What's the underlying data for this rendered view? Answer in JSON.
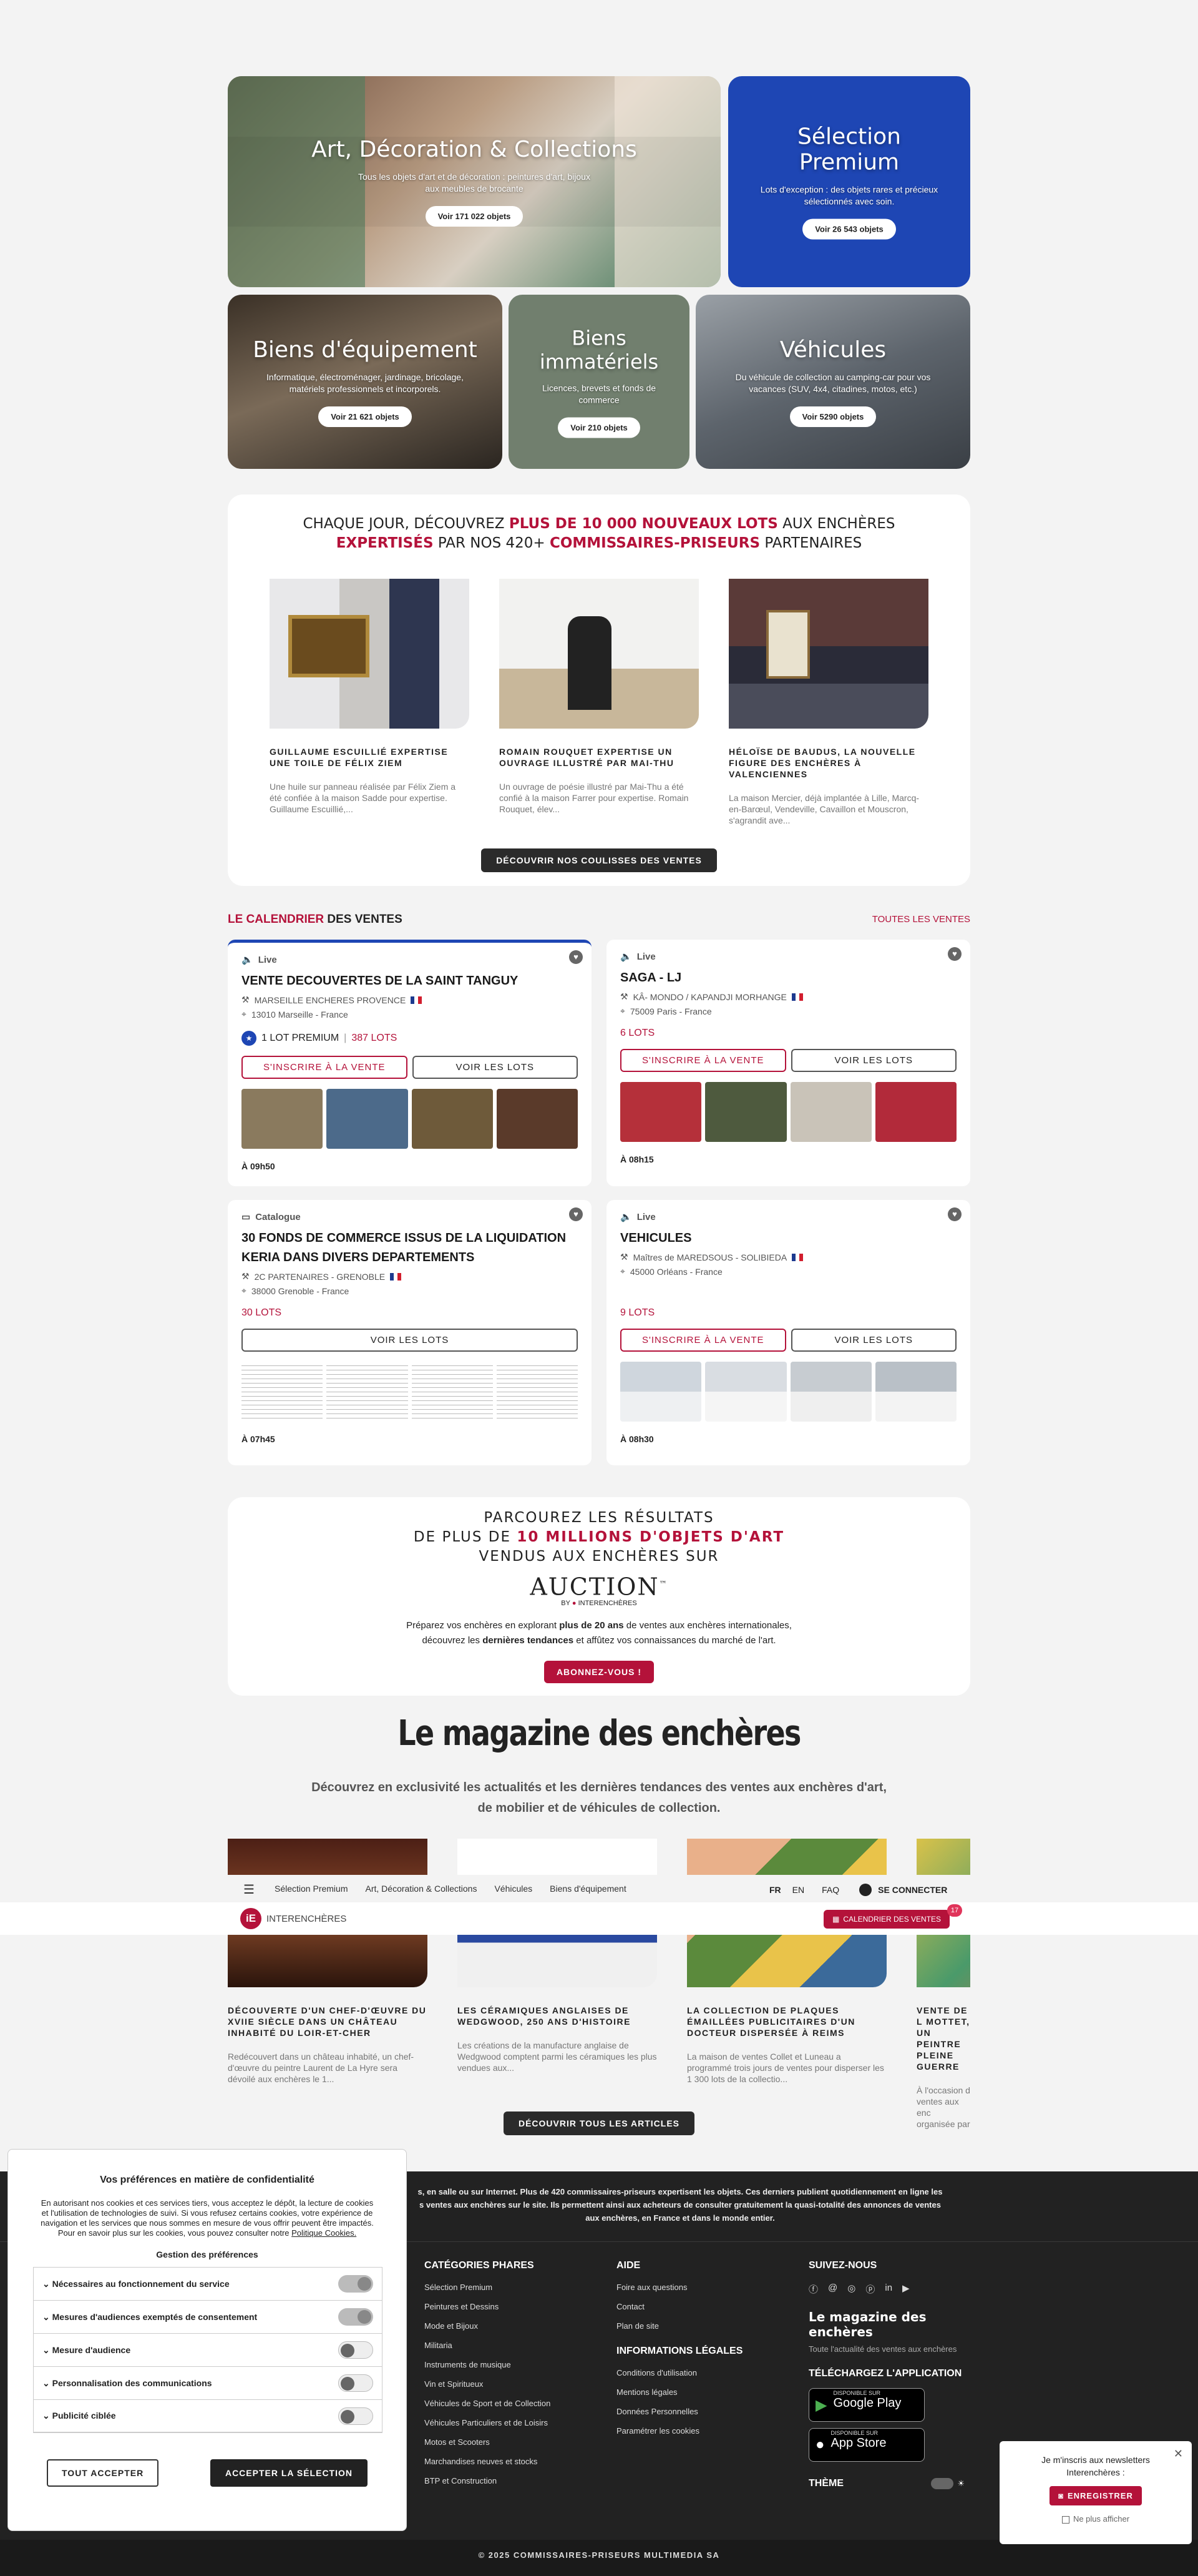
{
  "categories": [
    {
      "title": "Art, Décoration & Collections",
      "desc": "Tous les objets d'art et de décoration : peintures d'art, bijoux aux meubles de brocante",
      "btn": "Voir 171 022 objets"
    },
    {
      "title": "Sélection Premium",
      "desc": "Lots d'exception : des objets rares et précieux sélectionnés avec soin.",
      "btn": "Voir 26 543 objets"
    },
    {
      "title": "Biens d'équipement",
      "desc": "Informatique, électroménager, jardinage, bricolage, matériels professionnels et incorporels.",
      "btn": "Voir 21 621 objets"
    },
    {
      "title": "Biens immatériels",
      "desc": "Licences, brevets et fonds de commerce",
      "btn": "Voir 210 objets"
    },
    {
      "title": "Véhicules",
      "desc": "Du véhicule de collection au camping-car pour vos vacances (SUV, 4x4, citadines, motos, etc.)",
      "btn": "Voir 5290 objets"
    }
  ],
  "daily": {
    "l1a": "CHAQUE JOUR, DÉCOUVREZ ",
    "l1b": "PLUS DE 10 000 NOUVEAUX LOTS",
    "l1c": " AUX ENCHÈRES",
    "l2a": "EXPERTISÉS",
    "l2b": " PAR NOS 420+ ",
    "l2c": "COMMISSAIRES-PRISEURS",
    "l2d": " PARTENAIRES",
    "stories": [
      {
        "title": "GUILLAUME ESCUILLIÉ EXPERTISE UNE TOILE DE FÉLIX ZIEM",
        "text": "Une huile sur panneau réalisée par Félix Ziem a été confiée à la maison Sadde pour expertise. Guillaume Escuillié,..."
      },
      {
        "title": "ROMAIN ROUQUET EXPERTISE UN OUVRAGE ILLUSTRÉ PAR MAI-THU",
        "text": "Un ouvrage de poésie illustré par Mai-Thu a été confié à la maison Farrer pour expertise. Romain Rouquet, élev..."
      },
      {
        "title": "HÉLOÏSE DE BAUDUS, LA NOUVELLE FIGURE DES ENCHÈRES À VALENCIENNES",
        "text": "La maison Mercier, déjà implantée à Lille, Marcq-en-Barœul, Vendeville, Cavaillon et Mouscron, s'agrandit ave..."
      }
    ],
    "btn": "DÉCOUVRIR NOS COULISSES DES VENTES"
  },
  "calendar": {
    "t1": "LE CALENDRIER",
    "t2": " DES VENTES",
    "all": "TOUTES LES VENTES"
  },
  "sales": [
    {
      "type": "Live",
      "title": "VENTE DECOUVERTES DE LA SAINT TANGUY",
      "house": "MARSEILLE ENCHERES PROVENCE",
      "loc": "13010 Marseille - France",
      "premium": "1 LOT PREMIUM",
      "lots": "387 LOTS",
      "btn1": "S'INSCRIRE À LA VENTE",
      "btn2": "VOIR LES LOTS",
      "time": "À 09h50"
    },
    {
      "type": "Live",
      "title": "SAGA - LJ",
      "house": "KÂ- MONDO / KAPANDJI MORHANGE",
      "loc": "75009 Paris - France",
      "lots": "6 LOTS",
      "btn1": "S'INSCRIRE À LA VENTE",
      "btn2": "VOIR LES LOTS",
      "time": "À 08h15"
    },
    {
      "type": "Catalogue",
      "title": "30 FONDS DE COMMERCE ISSUS DE LA LIQUIDATION KERIA DANS DIVERS DEPARTEMENTS",
      "house": "2C PARTENAIRES - GRENOBLE",
      "loc": "38000 Grenoble - France",
      "lots": "30 LOTS",
      "btn2": "VOIR LES LOTS",
      "time": "À 07h45"
    },
    {
      "type": "Live",
      "title": "VEHICULES",
      "house": "Maîtres de MAREDSOUS - SOLIBIEDA",
      "loc": "45000 Orléans - France",
      "lots": "9 LOTS",
      "btn1": "S'INSCRIRE À LA VENTE",
      "btn2": "VOIR LES LOTS",
      "time": "À 08h30"
    }
  ],
  "results": {
    "l1": "PARCOUREZ LES RÉSULTATS",
    "l2a": "DE PLUS DE ",
    "l2b": "10 MILLIONS D'OBJETS D'ART",
    "l3": "VENDUS AUX ENCHÈRES SUR",
    "logo": "AUCTION",
    "logo_tm": "™",
    "logo_by": "BY",
    "logo_brand": "INTERENCHÈRES",
    "p1a": "Préparez vos enchères en explorant ",
    "p1b": "plus de 20 ans",
    "p1c": " de ventes aux enchères internationales,",
    "p2a": "découvrez les ",
    "p2b": "dernières tendances",
    "p2c": " et affûtez vos connaissances du marché de l'art.",
    "btn": "ABONNEZ-VOUS !"
  },
  "magazine": {
    "title": "Le magazine des enchères",
    "sub": "Découvrez en exclusivité les actualités et les dernières tendances des ventes aux enchères d'art, de mobilier et de véhicules de collection.",
    "articles": [
      {
        "title": "DÉCOUVERTE D'UN CHEF-D'ŒUVRE DU XVIIE SIÈCLE DANS UN CHÂTEAU INHABITÉ DU LOIR-ET-CHER",
        "text": "Redécouvert dans un château inhabité, un chef-d'œuvre du peintre Laurent de La Hyre sera dévoilé aux enchères le 1..."
      },
      {
        "title": "LES CÉRAMIQUES ANGLAISES DE WEDGWOOD, 250 ANS D'HISTOIRE",
        "text": "Les créations de la manufacture anglaise de Wedgwood comptent parmi les céramiques les plus vendues aux..."
      },
      {
        "title": "LA COLLECTION DE PLAQUES ÉMAILLÉES PUBLICITAIRES D'UN DOCTEUR DISPERSÉE À REIMS",
        "text": "La maison de ventes Collet et Luneau a programmé trois jours de ventes pour disperser les 1 300 lots de la collectio..."
      },
      {
        "title": "VENTE DE L MOTTET, UN PEINTRE PLEINE GUERRE",
        "text": "À l'occasion d ventes aux enc organisée par"
      }
    ],
    "btn": "DÉCOUVRIR TOUS LES ARTICLES"
  },
  "nav": {
    "items": [
      "Sélection Premium",
      "Art, Décoration & Collections",
      "Véhicules",
      "Biens d'équipement"
    ],
    "fr": "FR",
    "en": "EN",
    "faq": "FAQ",
    "login": "SE CONNECTER",
    "brand": "INTERENCHÈRES",
    "cal": "CALENDRIER DES VENTES",
    "badge": "17"
  },
  "footer": {
    "intro1": "s, en salle ou sur Internet. Plus de 420 commissaires-priseurs expertisent les objets. Ces derniers publient quotidiennement en ligne les",
    "intro2": "s ventes aux enchères sur le site. Ils permettent ainsi aux acheteurs de consulter gratuitement la quasi-totalité des annonces de ventes",
    "intro3": "aux enchères, en France et dans le monde entier.",
    "cat_title": "CATÉGORIES PHARES",
    "cats": [
      "Sélection Premium",
      "Peintures et Dessins",
      "Mode et Bijoux",
      "Militaria",
      "Instruments de musique",
      "Vin et Spiritueux",
      "Véhicules de Sport et de Collection",
      "Véhicules Particuliers et de Loisirs",
      "Motos et Scooters",
      "Marchandises neuves et stocks",
      "BTP et Construction"
    ],
    "aide_title": "AIDE",
    "aide": [
      "Foire aux questions",
      "Contact",
      "Plan de site"
    ],
    "legal_title": "INFORMATIONS LÉGALES",
    "legal": [
      "Conditions d'utilisation",
      "Mentions légales",
      "Données Personnelles",
      "Paramétrer les cookies"
    ],
    "follow": "SUIVEZ-NOUS",
    "mag": "Le magazine des enchères",
    "mag_sub": "Toute l'actualité des ventes aux enchères",
    "app": "TÉLÉCHARGEZ L'APPLICATION",
    "gp_small": "DISPONIBLE SUR",
    "gp": "Google Play",
    "as_small": "DISPONIBLE SUR",
    "as": "App Store",
    "theme": "THÈME",
    "copy": "© 2025 COMMISSAIRES-PRISEURS MULTIMEDIA SA"
  },
  "cookies": {
    "title": "Vos préférences en matière de confidentialité",
    "text": "En autorisant nos cookies et ces services tiers, vous acceptez le dépôt, la lecture de cookies et l'utilisation de technologies de suivi. Si vous refusez certains cookies, votre expérience de navigation et les services que nous sommes en mesure de vous offrir peuvent être impactés.",
    "more": "Pour en savoir plus sur les cookies, vous pouvez consulter notre ",
    "link": "Politique Cookies.",
    "sub": "Gestion des préférences",
    "prefs": [
      "Nécessaires au fonctionnement du service",
      "Mesures d'audiences exemptés de consentement",
      "Mesure d'audience",
      "Personnalisation des communications",
      "Publicité ciblée"
    ],
    "accept_all": "TOUT ACCEPTER",
    "accept_sel": "ACCEPTER LA SÉLECTION"
  },
  "newsletter": {
    "l1": "Je m'inscris aux newsletters",
    "l2": "Interenchères :",
    "btn": "ENREGISTRER",
    "no": "Ne plus afficher"
  }
}
